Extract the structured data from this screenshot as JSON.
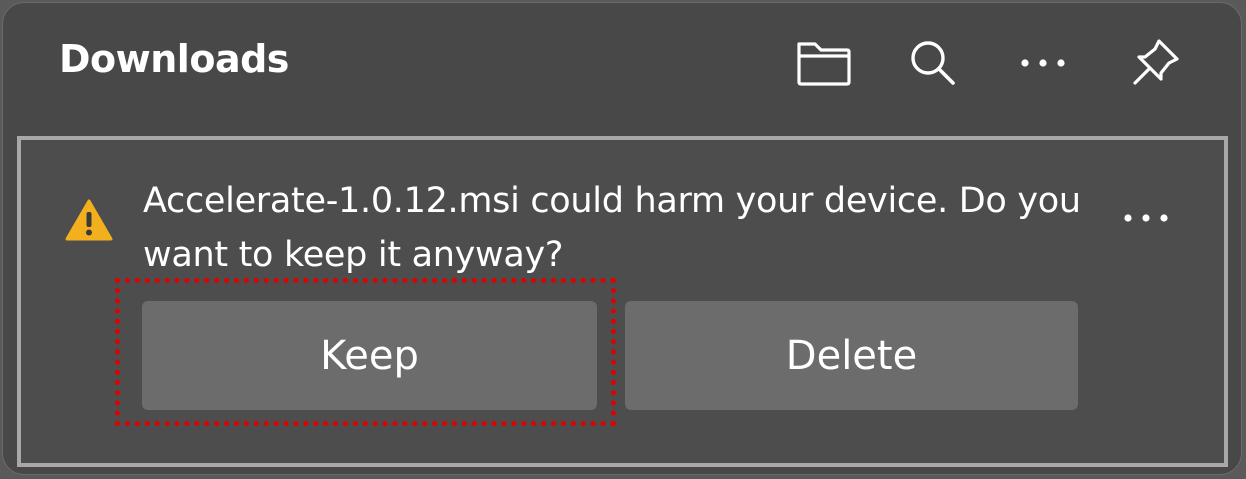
{
  "panel": {
    "title": "Downloads",
    "actions": [
      {
        "name": "open-downloads-folder",
        "icon": "folder-icon"
      },
      {
        "name": "search-downloads",
        "icon": "search-icon"
      },
      {
        "name": "more-options",
        "icon": "more-horizontal-icon"
      },
      {
        "name": "pin-downloads",
        "icon": "pin-icon"
      }
    ]
  },
  "download_item": {
    "status_icon": "warning-icon",
    "status_color": "#f2b01e",
    "message": "Accelerate-1.0.12.msi could harm your device. Do you want to keep it anyway?",
    "more_icon": "more-horizontal-icon",
    "keep_label": "Keep",
    "delete_label": "Delete"
  },
  "highlight_color": "#e00000"
}
